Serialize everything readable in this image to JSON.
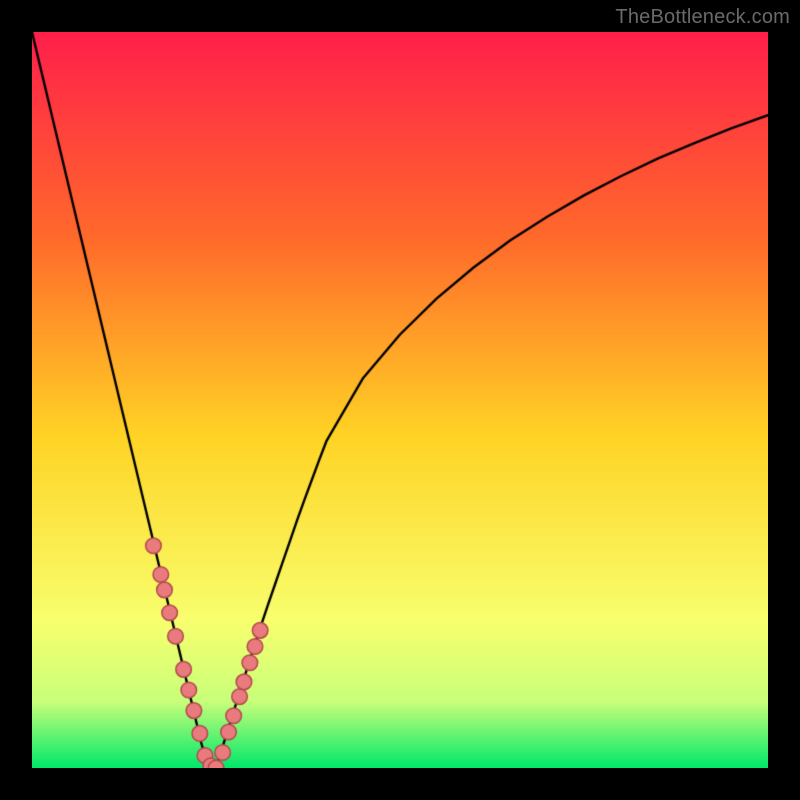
{
  "watermark": "TheBottleneck.com",
  "colors": {
    "bg_black": "#000000",
    "gradient_top": "#ff1f4b",
    "gradient_mid_upper": "#ff6a2b",
    "gradient_mid": "#ffd425",
    "gradient_low": "#f8ff6e",
    "gradient_near_bottom": "#c8ff7a",
    "gradient_bottom": "#00e86a",
    "curve": "#000000",
    "marker_fill": "#e97a7d",
    "marker_stroke": "#b24a4d",
    "watermark_text": "#6a6a6a"
  },
  "chart_data": {
    "type": "line",
    "title": "",
    "xlabel": "",
    "ylabel": "",
    "xlim": [
      0,
      100
    ],
    "ylim": [
      0,
      100
    ],
    "gradient_stops": [
      {
        "offset": 0.0,
        "color": "#ff1f4b"
      },
      {
        "offset": 0.28,
        "color": "#ff6a2b"
      },
      {
        "offset": 0.55,
        "color": "#ffd425"
      },
      {
        "offset": 0.8,
        "color": "#f8ff6e"
      },
      {
        "offset": 0.91,
        "color": "#c8ff7a"
      },
      {
        "offset": 1.0,
        "color": "#00e86a"
      }
    ],
    "series": [
      {
        "name": "curve",
        "kind": "curve",
        "x": [
          0,
          1,
          2,
          3,
          4,
          5,
          6,
          7,
          8,
          9,
          10,
          11,
          12,
          13,
          14,
          15,
          16,
          17,
          18,
          19,
          20,
          21,
          22,
          23,
          24,
          25,
          26,
          27,
          28,
          29,
          30,
          31,
          32,
          33,
          34,
          35,
          36,
          37,
          38,
          39,
          40,
          45,
          50,
          55,
          60,
          65,
          70,
          75,
          80,
          85,
          90,
          95,
          100
        ],
        "y": [
          100.0,
          95.8,
          91.6,
          87.4,
          83.2,
          79.0,
          74.8,
          70.6,
          66.4,
          62.2,
          58.0,
          53.8,
          49.6,
          45.4,
          41.2,
          37.0,
          32.8,
          28.6,
          24.4,
          20.2,
          16.0,
          11.8,
          7.6,
          3.4,
          0.0,
          0.0,
          3.2,
          6.4,
          9.6,
          12.8,
          16.0,
          19.0,
          22.0,
          24.9,
          27.8,
          30.7,
          33.6,
          36.4,
          39.1,
          41.8,
          44.4,
          53.0,
          58.9,
          63.8,
          68.0,
          71.7,
          74.9,
          77.8,
          80.4,
          82.8,
          84.9,
          86.9,
          88.7
        ]
      },
      {
        "name": "highlighted-points",
        "kind": "markers",
        "x": [
          16.5,
          17.5,
          18.0,
          18.7,
          19.5,
          20.6,
          21.3,
          22.0,
          22.8,
          23.5,
          24.3,
          25.0,
          25.9,
          26.7,
          27.4,
          28.2,
          28.8,
          29.6,
          30.3,
          31.0
        ],
        "y": [
          30.2,
          26.3,
          24.2,
          21.1,
          17.9,
          13.4,
          10.6,
          7.8,
          4.7,
          1.7,
          0.3,
          0.0,
          2.1,
          4.9,
          7.1,
          9.7,
          11.7,
          14.3,
          16.5,
          18.7
        ]
      }
    ]
  }
}
